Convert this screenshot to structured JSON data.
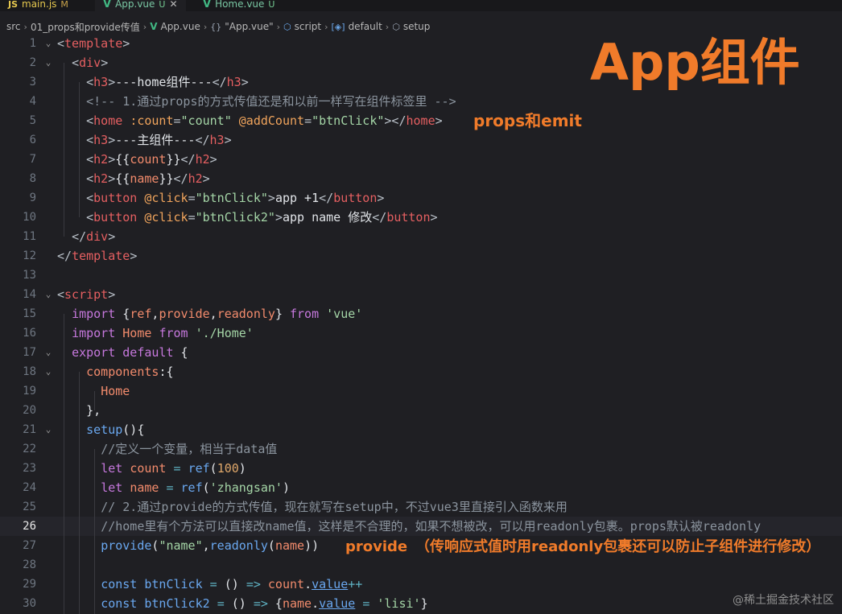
{
  "tabs": [
    {
      "icon": "JS",
      "label": "main.js",
      "badge": "M"
    },
    {
      "icon": "V",
      "label": "App.vue",
      "badge": "U",
      "close": "✕"
    },
    {
      "icon": "V",
      "label": "Home.vue",
      "badge": "U"
    }
  ],
  "breadcrumb": {
    "src": "src",
    "folder": "01_props和provide传值",
    "file": "App.vue",
    "obj": "\"App.vue\"",
    "script": "script",
    "default": "default",
    "setup": "setup"
  },
  "current_line": 26,
  "lines": [
    {
      "n": 1,
      "fold": "⌄",
      "code": [
        [
          "t-br",
          "<"
        ],
        [
          "t-tag",
          "template"
        ],
        [
          "t-br",
          ">"
        ]
      ]
    },
    {
      "n": 2,
      "fold": "⌄",
      "code": [
        [
          "t-text",
          "  "
        ],
        [
          "t-br",
          "<"
        ],
        [
          "t-tag",
          "div"
        ],
        [
          "t-br",
          ">"
        ]
      ]
    },
    {
      "n": 3,
      "code": [
        [
          "t-text",
          "    "
        ],
        [
          "t-br",
          "<"
        ],
        [
          "t-tag",
          "h3"
        ],
        [
          "t-br",
          ">"
        ],
        [
          "t-text",
          "---home组件---"
        ],
        [
          "t-br",
          "</"
        ],
        [
          "t-tag",
          "h3"
        ],
        [
          "t-br",
          ">"
        ]
      ]
    },
    {
      "n": 4,
      "code": [
        [
          "t-text",
          "    "
        ],
        [
          "t-cm",
          "<!-- 1.通过props的方式传值还是和以前一样写在组件标签里 -->"
        ]
      ]
    },
    {
      "n": 5,
      "code": [
        [
          "t-text",
          "    "
        ],
        [
          "t-br",
          "<"
        ],
        [
          "t-tag",
          "home"
        ],
        [
          "t-text",
          " "
        ],
        [
          "t-attr",
          ":count"
        ],
        [
          "t-br",
          "="
        ],
        [
          "t-str",
          "\"count\""
        ],
        [
          "t-text",
          " "
        ],
        [
          "t-attr",
          "@addCount"
        ],
        [
          "t-br",
          "="
        ],
        [
          "t-str",
          "\"btnClick\""
        ],
        [
          "t-br",
          "></"
        ],
        [
          "t-tag",
          "home"
        ],
        [
          "t-br",
          ">"
        ]
      ]
    },
    {
      "n": 6,
      "code": [
        [
          "t-text",
          "    "
        ],
        [
          "t-br",
          "<"
        ],
        [
          "t-tag",
          "h3"
        ],
        [
          "t-br",
          ">"
        ],
        [
          "t-text",
          "---主组件---"
        ],
        [
          "t-br",
          "</"
        ],
        [
          "t-tag",
          "h3"
        ],
        [
          "t-br",
          ">"
        ]
      ]
    },
    {
      "n": 7,
      "code": [
        [
          "t-text",
          "    "
        ],
        [
          "t-br",
          "<"
        ],
        [
          "t-tag",
          "h2"
        ],
        [
          "t-br",
          ">"
        ],
        [
          "t-text",
          "{{"
        ],
        [
          "t-var",
          "count"
        ],
        [
          "t-text",
          "}}"
        ],
        [
          "t-br",
          "</"
        ],
        [
          "t-tag",
          "h2"
        ],
        [
          "t-br",
          ">"
        ]
      ]
    },
    {
      "n": 8,
      "code": [
        [
          "t-text",
          "    "
        ],
        [
          "t-br",
          "<"
        ],
        [
          "t-tag",
          "h2"
        ],
        [
          "t-br",
          ">"
        ],
        [
          "t-text",
          "{{"
        ],
        [
          "t-var",
          "name"
        ],
        [
          "t-text",
          "}}"
        ],
        [
          "t-br",
          "</"
        ],
        [
          "t-tag",
          "h2"
        ],
        [
          "t-br",
          ">"
        ]
      ]
    },
    {
      "n": 9,
      "code": [
        [
          "t-text",
          "    "
        ],
        [
          "t-br",
          "<"
        ],
        [
          "t-tag",
          "button"
        ],
        [
          "t-text",
          " "
        ],
        [
          "t-attr",
          "@click"
        ],
        [
          "t-br",
          "="
        ],
        [
          "t-str",
          "\"btnClick\""
        ],
        [
          "t-br",
          ">"
        ],
        [
          "t-text",
          "app +1"
        ],
        [
          "t-br",
          "</"
        ],
        [
          "t-tag",
          "button"
        ],
        [
          "t-br",
          ">"
        ]
      ]
    },
    {
      "n": 10,
      "code": [
        [
          "t-text",
          "    "
        ],
        [
          "t-br",
          "<"
        ],
        [
          "t-tag",
          "button"
        ],
        [
          "t-text",
          " "
        ],
        [
          "t-attr",
          "@click"
        ],
        [
          "t-br",
          "="
        ],
        [
          "t-str",
          "\"btnClick2\""
        ],
        [
          "t-br",
          ">"
        ],
        [
          "t-text",
          "app name 修改"
        ],
        [
          "t-br",
          "</"
        ],
        [
          "t-tag",
          "button"
        ],
        [
          "t-br",
          ">"
        ]
      ]
    },
    {
      "n": 11,
      "code": [
        [
          "t-text",
          "  "
        ],
        [
          "t-br",
          "</"
        ],
        [
          "t-tag",
          "div"
        ],
        [
          "t-br",
          ">"
        ]
      ]
    },
    {
      "n": 12,
      "code": [
        [
          "t-br",
          "</"
        ],
        [
          "t-tag",
          "template"
        ],
        [
          "t-br",
          ">"
        ]
      ]
    },
    {
      "n": 13,
      "code": []
    },
    {
      "n": 14,
      "fold": "⌄",
      "code": [
        [
          "t-br",
          "<"
        ],
        [
          "t-tag",
          "script"
        ],
        [
          "t-br",
          ">"
        ]
      ]
    },
    {
      "n": 15,
      "code": [
        [
          "t-text",
          "  "
        ],
        [
          "t-kw",
          "import"
        ],
        [
          "t-text",
          " {"
        ],
        [
          "t-var",
          "ref"
        ],
        [
          "t-text",
          ","
        ],
        [
          "t-var",
          "provide"
        ],
        [
          "t-text",
          ","
        ],
        [
          "t-var",
          "readonly"
        ],
        [
          "t-text",
          "} "
        ],
        [
          "t-kw",
          "from"
        ],
        [
          "t-text",
          " "
        ],
        [
          "t-str",
          "'vue'"
        ]
      ]
    },
    {
      "n": 16,
      "code": [
        [
          "t-text",
          "  "
        ],
        [
          "t-kw",
          "import"
        ],
        [
          "t-text",
          " "
        ],
        [
          "t-var",
          "Home"
        ],
        [
          "t-text",
          " "
        ],
        [
          "t-kw",
          "from"
        ],
        [
          "t-text",
          " "
        ],
        [
          "t-str",
          "'./Home'"
        ]
      ]
    },
    {
      "n": 17,
      "fold": "⌄",
      "code": [
        [
          "t-text",
          "  "
        ],
        [
          "t-kw",
          "export"
        ],
        [
          "t-text",
          " "
        ],
        [
          "t-kw",
          "default"
        ],
        [
          "t-text",
          " {"
        ]
      ]
    },
    {
      "n": 18,
      "fold": "⌄",
      "code": [
        [
          "t-text",
          "    "
        ],
        [
          "t-var",
          "components"
        ],
        [
          "t-text",
          ":{"
        ]
      ]
    },
    {
      "n": 19,
      "code": [
        [
          "t-text",
          "      "
        ],
        [
          "t-var",
          "Home"
        ]
      ]
    },
    {
      "n": 20,
      "code": [
        [
          "t-text",
          "    },"
        ]
      ]
    },
    {
      "n": 21,
      "fold": "⌄",
      "code": [
        [
          "t-text",
          "    "
        ],
        [
          "t-fn",
          "setup"
        ],
        [
          "t-text",
          "(){"
        ]
      ]
    },
    {
      "n": 22,
      "code": [
        [
          "t-text",
          "      "
        ],
        [
          "t-cm",
          "//定义一个变量，相当于data值"
        ]
      ]
    },
    {
      "n": 23,
      "code": [
        [
          "t-text",
          "      "
        ],
        [
          "t-kw",
          "let"
        ],
        [
          "t-text",
          " "
        ],
        [
          "t-var",
          "count"
        ],
        [
          "t-text",
          " "
        ],
        [
          "t-op",
          "="
        ],
        [
          "t-text",
          " "
        ],
        [
          "t-fn",
          "ref"
        ],
        [
          "t-text",
          "("
        ],
        [
          "t-num",
          "100"
        ],
        [
          "t-text",
          ")"
        ]
      ]
    },
    {
      "n": 24,
      "code": [
        [
          "t-text",
          "      "
        ],
        [
          "t-kw",
          "let"
        ],
        [
          "t-text",
          " "
        ],
        [
          "t-var",
          "name"
        ],
        [
          "t-text",
          " "
        ],
        [
          "t-op",
          "="
        ],
        [
          "t-text",
          " "
        ],
        [
          "t-fn",
          "ref"
        ],
        [
          "t-text",
          "("
        ],
        [
          "t-str",
          "'zhangsan'"
        ],
        [
          "t-text",
          ")"
        ]
      ]
    },
    {
      "n": 25,
      "code": [
        [
          "t-text",
          "      "
        ],
        [
          "t-cm",
          "// 2.通过provide的方式传值，现在就写在setup中，不过vue3里直接引入函数来用"
        ]
      ]
    },
    {
      "n": 26,
      "code": [
        [
          "t-text",
          "      "
        ],
        [
          "t-cm",
          "//home里有个方法可以直接改name值，这样是不合理的，如果不想被改，可以用readonly包裹。props默认被readonly"
        ]
      ]
    },
    {
      "n": 27,
      "code": [
        [
          "t-text",
          "      "
        ],
        [
          "t-fn",
          "provide"
        ],
        [
          "t-text",
          "("
        ],
        [
          "t-str",
          "\"name\""
        ],
        [
          "t-text",
          ","
        ],
        [
          "t-fn",
          "readonly"
        ],
        [
          "t-text",
          "("
        ],
        [
          "t-var",
          "name"
        ],
        [
          "t-text",
          "))"
        ]
      ]
    },
    {
      "n": 28,
      "code": []
    },
    {
      "n": 29,
      "code": [
        [
          "t-text",
          "      "
        ],
        [
          "t-fn",
          "const"
        ],
        [
          "t-text",
          " "
        ],
        [
          "t-fn",
          "btnClick"
        ],
        [
          "t-text",
          " "
        ],
        [
          "t-op",
          "="
        ],
        [
          "t-text",
          " () "
        ],
        [
          "t-op",
          "=>"
        ],
        [
          "t-text",
          " "
        ],
        [
          "t-var",
          "count"
        ],
        [
          "t-text",
          "."
        ],
        [
          "t-ul",
          "value"
        ],
        [
          "t-op",
          "++"
        ]
      ]
    },
    {
      "n": 30,
      "code": [
        [
          "t-text",
          "      "
        ],
        [
          "t-fn",
          "const"
        ],
        [
          "t-text",
          " "
        ],
        [
          "t-fn",
          "btnClick2"
        ],
        [
          "t-text",
          " "
        ],
        [
          "t-op",
          "="
        ],
        [
          "t-text",
          " () "
        ],
        [
          "t-op",
          "=>"
        ],
        [
          "t-text",
          " {"
        ],
        [
          "t-var",
          "name"
        ],
        [
          "t-text",
          "."
        ],
        [
          "t-ul",
          "value"
        ],
        [
          "t-text",
          " "
        ],
        [
          "t-op",
          "="
        ],
        [
          "t-text",
          " "
        ],
        [
          "t-str",
          "'lisi'"
        ],
        [
          "t-text",
          "}"
        ]
      ]
    }
  ],
  "annotations": {
    "title": "App组件",
    "props_emit": "props和emit",
    "provide": "provide",
    "provide_note": "（传响应式值时用readonly包裹还可以防止子组件进行修改）"
  },
  "watermark": "@稀土掘金技术社区",
  "colors": {
    "annotation": "#f07b2a",
    "background": "#1f1f23"
  }
}
